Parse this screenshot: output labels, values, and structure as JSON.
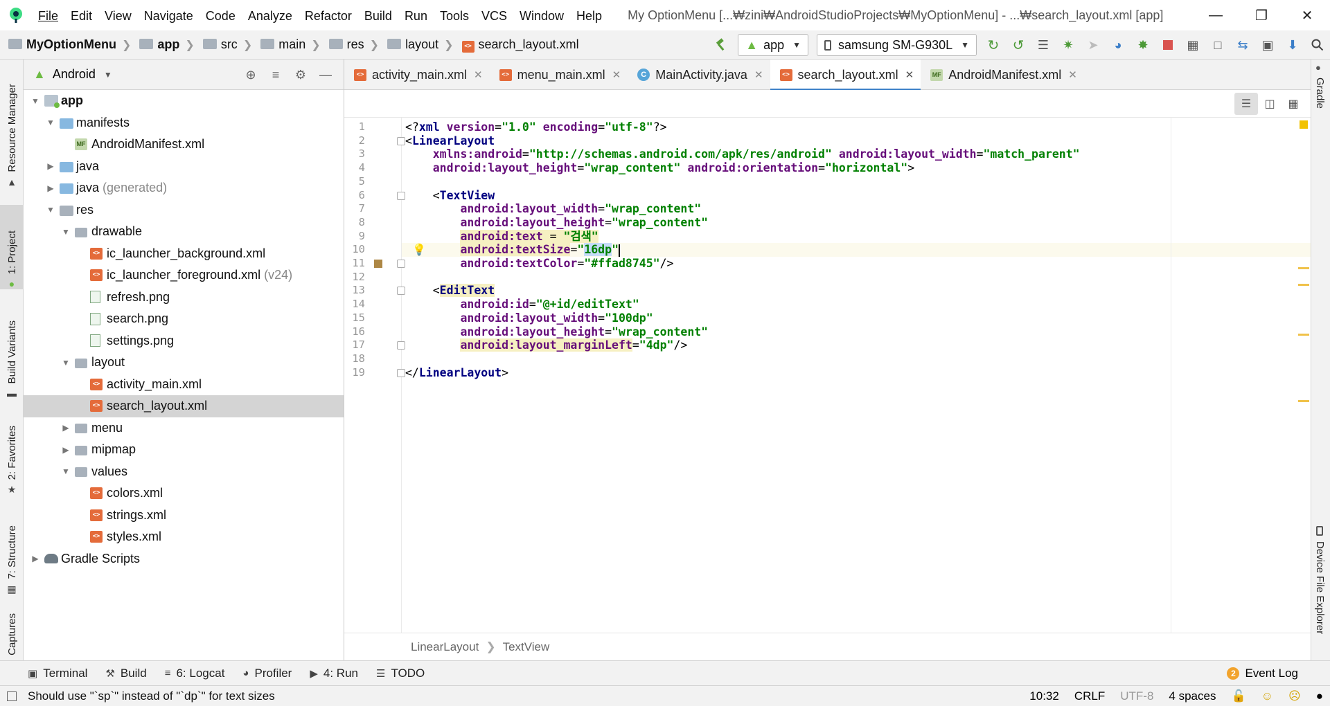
{
  "menubar": {
    "items": [
      "File",
      "Edit",
      "View",
      "Navigate",
      "Code",
      "Analyze",
      "Refactor",
      "Build",
      "Run",
      "Tools",
      "VCS",
      "Window",
      "Help"
    ],
    "window_title": "My OptionMenu [...₩zini₩AndroidStudioProjects₩MyOptionMenu] - ...₩search_layout.xml [app]"
  },
  "navbar": {
    "breadcrumbs": [
      "MyOptionMenu",
      "app",
      "src",
      "main",
      "res",
      "layout",
      "search_layout.xml"
    ],
    "run_config": "app",
    "device": "samsung SM-G930L"
  },
  "left_strip": {
    "tabs": [
      "Resource Manager",
      "1: Project",
      "Build Variants",
      "2: Favorites",
      "7: Structure",
      "Captures"
    ]
  },
  "right_strip": {
    "tabs": [
      "Gradle",
      "Device File Explorer"
    ]
  },
  "project_panel": {
    "view_mode": "Android",
    "tree": [
      {
        "label": "app",
        "level": 0,
        "toggle": "down",
        "icon": "module",
        "bold": true
      },
      {
        "label": "manifests",
        "level": 1,
        "toggle": "down",
        "icon": "folder-blue"
      },
      {
        "label": "AndroidManifest.xml",
        "level": 2,
        "toggle": "",
        "icon": "manifest"
      },
      {
        "label": "java",
        "level": 1,
        "toggle": "right",
        "icon": "folder-blue"
      },
      {
        "label": "java",
        "suffix": "(generated)",
        "level": 1,
        "toggle": "right",
        "icon": "folder-gen"
      },
      {
        "label": "res",
        "level": 1,
        "toggle": "down",
        "icon": "folder-res"
      },
      {
        "label": "drawable",
        "level": 2,
        "toggle": "down",
        "icon": "folder"
      },
      {
        "label": "ic_launcher_background.xml",
        "level": 3,
        "toggle": "",
        "icon": "xml"
      },
      {
        "label": "ic_launcher_foreground.xml",
        "suffix": "(v24)",
        "level": 3,
        "toggle": "",
        "icon": "xml"
      },
      {
        "label": "refresh.png",
        "level": 3,
        "toggle": "",
        "icon": "png"
      },
      {
        "label": "search.png",
        "level": 3,
        "toggle": "",
        "icon": "png"
      },
      {
        "label": "settings.png",
        "level": 3,
        "toggle": "",
        "icon": "png"
      },
      {
        "label": "layout",
        "level": 2,
        "toggle": "down",
        "icon": "folder"
      },
      {
        "label": "activity_main.xml",
        "level": 3,
        "toggle": "",
        "icon": "xml"
      },
      {
        "label": "search_layout.xml",
        "level": 3,
        "toggle": "",
        "icon": "xml",
        "selected": true
      },
      {
        "label": "menu",
        "level": 2,
        "toggle": "right",
        "icon": "folder"
      },
      {
        "label": "mipmap",
        "level": 2,
        "toggle": "right",
        "icon": "folder"
      },
      {
        "label": "values",
        "level": 2,
        "toggle": "down",
        "icon": "folder"
      },
      {
        "label": "colors.xml",
        "level": 3,
        "toggle": "",
        "icon": "xml"
      },
      {
        "label": "strings.xml",
        "level": 3,
        "toggle": "",
        "icon": "xml"
      },
      {
        "label": "styles.xml",
        "level": 3,
        "toggle": "",
        "icon": "xml"
      },
      {
        "label": "Gradle Scripts",
        "level": 0,
        "toggle": "right",
        "icon": "gradle"
      }
    ]
  },
  "editor": {
    "tabs": [
      {
        "label": "activity_main.xml",
        "icon": "xml",
        "active": false
      },
      {
        "label": "menu_main.xml",
        "icon": "xml",
        "active": false
      },
      {
        "label": "MainActivity.java",
        "icon": "java",
        "active": false
      },
      {
        "label": "search_layout.xml",
        "icon": "xml",
        "active": true
      },
      {
        "label": "AndroidManifest.xml",
        "icon": "manifest",
        "active": false
      }
    ],
    "current_line": 10,
    "lines": [
      [
        [
          "plain",
          "<?"
        ],
        [
          "tag",
          "xml "
        ],
        [
          "attr",
          "version"
        ],
        [
          "plain",
          "="
        ],
        [
          "val",
          "\"1.0\""
        ],
        [
          "plain",
          " "
        ],
        [
          "attr",
          "encoding"
        ],
        [
          "plain",
          "="
        ],
        [
          "val",
          "\"utf-8\""
        ],
        [
          "plain",
          "?>"
        ]
      ],
      [
        [
          "plain",
          "<"
        ],
        [
          "tag",
          "LinearLayout"
        ]
      ],
      [
        [
          "plain",
          "    "
        ],
        [
          "attr",
          "xmlns:android"
        ],
        [
          "plain",
          "="
        ],
        [
          "val",
          "\"http://schemas.android.com/apk/res/android\""
        ],
        [
          "plain",
          " "
        ],
        [
          "attr",
          "android:layout_width"
        ],
        [
          "plain",
          "="
        ],
        [
          "val",
          "\"match_parent\""
        ]
      ],
      [
        [
          "plain",
          "    "
        ],
        [
          "attr",
          "android:layout_height"
        ],
        [
          "plain",
          "="
        ],
        [
          "val",
          "\"wrap_content\""
        ],
        [
          "plain",
          " "
        ],
        [
          "attr",
          "android:orientation"
        ],
        [
          "plain",
          "="
        ],
        [
          "val",
          "\"horizontal\""
        ],
        [
          "plain",
          ">"
        ]
      ],
      [],
      [
        [
          "plain",
          "    <"
        ],
        [
          "tag",
          "TextView"
        ]
      ],
      [
        [
          "plain",
          "        "
        ],
        [
          "attr",
          "android:layout_width"
        ],
        [
          "plain",
          "="
        ],
        [
          "val",
          "\"wrap_content\""
        ]
      ],
      [
        [
          "plain",
          "        "
        ],
        [
          "attr",
          "android:layout_height"
        ],
        [
          "plain",
          "="
        ],
        [
          "val",
          "\"wrap_content\""
        ]
      ],
      [
        [
          "plain",
          "        "
        ],
        [
          "attr hl",
          "android:text"
        ],
        [
          "plain hl",
          " = "
        ],
        [
          "val hl",
          "\"검색\""
        ]
      ],
      [
        [
          "plain",
          "        "
        ],
        [
          "attr hl",
          "android:textSize"
        ],
        [
          "plain",
          "="
        ],
        [
          "val",
          "\""
        ],
        [
          "val sel",
          "16dp"
        ],
        [
          "val",
          "\""
        ],
        [
          "plain",
          "|"
        ]
      ],
      [
        [
          "plain",
          "        "
        ],
        [
          "attr",
          "android:textColor"
        ],
        [
          "plain",
          "="
        ],
        [
          "val",
          "\"#ffad8745\""
        ],
        [
          "plain",
          "/>"
        ]
      ],
      [],
      [
        [
          "plain",
          "    <"
        ],
        [
          "tag hl",
          "EditText"
        ]
      ],
      [
        [
          "plain",
          "        "
        ],
        [
          "attr",
          "android:id"
        ],
        [
          "plain",
          "="
        ],
        [
          "val",
          "\"@+id/editText\""
        ]
      ],
      [
        [
          "plain",
          "        "
        ],
        [
          "attr",
          "android:layout_width"
        ],
        [
          "plain",
          "="
        ],
        [
          "val",
          "\"100dp\""
        ]
      ],
      [
        [
          "plain",
          "        "
        ],
        [
          "attr",
          "android:layout_height"
        ],
        [
          "plain",
          "="
        ],
        [
          "val",
          "\"wrap_content\""
        ]
      ],
      [
        [
          "plain",
          "        "
        ],
        [
          "attr hl",
          "android:layout_marginLeft"
        ],
        [
          "plain",
          "="
        ],
        [
          "val",
          "\"4dp\""
        ],
        [
          "plain",
          "/>"
        ]
      ],
      [],
      [
        [
          "plain",
          "</"
        ],
        [
          "tag",
          "LinearLayout"
        ],
        [
          "plain",
          ">"
        ]
      ]
    ],
    "breadcrumb": [
      "LinearLayout",
      "TextView"
    ]
  },
  "bottom_tabs": [
    "Terminal",
    "Build",
    "6: Logcat",
    "Profiler",
    "4: Run",
    "TODO"
  ],
  "event_log": {
    "label": "Event Log",
    "count": "2"
  },
  "statusbar": {
    "message": "Should use \"`sp`\" instead of \"`dp`\" for text sizes",
    "position": "10:32",
    "line_sep": "CRLF",
    "encoding": "UTF-8",
    "indent": "4 spaces"
  },
  "colors": {
    "accent": "#4083c9",
    "xml_tag": "#000080",
    "xml_attr": "#660e7a",
    "xml_value": "#008000"
  }
}
